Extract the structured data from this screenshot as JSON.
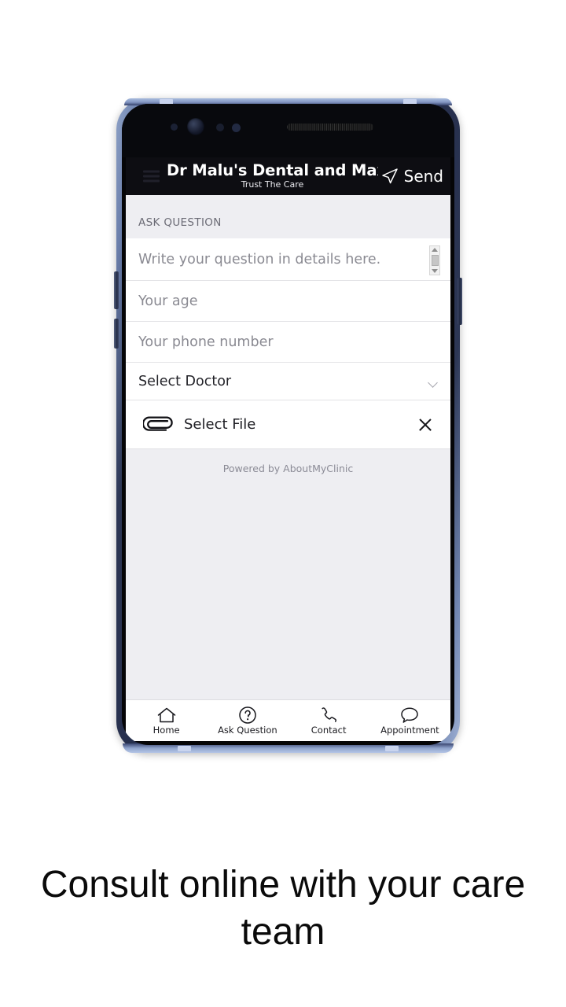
{
  "app": {
    "title": "Dr Malu's Dental and Max...",
    "subtitle": "Trust The Care",
    "menu_icon": "hamburger-menu-icon",
    "send_label": "Send",
    "send_icon": "send-paper-plane-icon"
  },
  "section": {
    "heading": "ASK QUESTION"
  },
  "form": {
    "question_placeholder": "Write your question in details here.",
    "age_placeholder": "Your age",
    "phone_placeholder": "Your phone number",
    "doctor_value": "Select Doctor",
    "doctor_chevron": "chevron-down-icon",
    "file_label": "Select File",
    "file_icon": "paperclip-icon",
    "clear_icon": "close-x-icon"
  },
  "footer": {
    "powered_by": "Powered by AboutMyClinic"
  },
  "bottom_nav": [
    {
      "label": "Home",
      "icon": "home-icon"
    },
    {
      "label": "Ask Question",
      "icon": "question-circle-icon"
    },
    {
      "label": "Contact",
      "icon": "phone-icon"
    },
    {
      "label": "Appointment",
      "icon": "chat-bubble-icon"
    }
  ],
  "caption": {
    "text": "Consult online with your care team"
  },
  "colors": {
    "appbar_bg": "#0d0d12",
    "screen_bg": "#eeeef2",
    "card_bg": "#ffffff",
    "placeholder": "#8a8a92",
    "text": "#222228",
    "device_frame": "#2c3654"
  }
}
